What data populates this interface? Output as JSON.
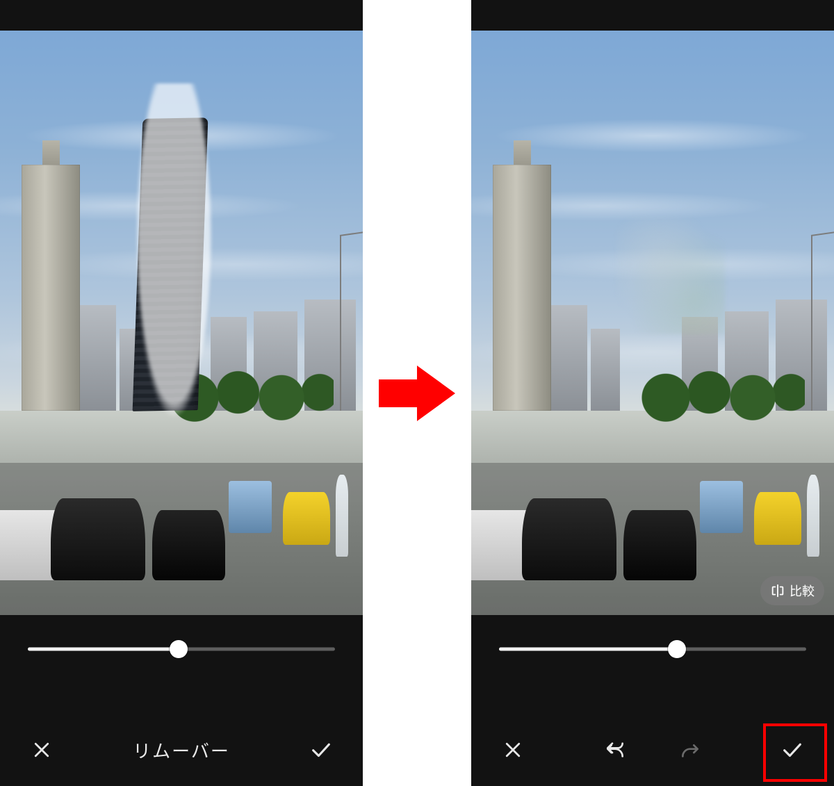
{
  "left": {
    "tool_title": "リムーバー",
    "slider_percent": 49,
    "show_skyscraper": true,
    "show_brush_mask": true
  },
  "right": {
    "compare_label": "比較",
    "slider_percent": 58,
    "show_skyscraper": false
  },
  "icons": {
    "close": "close-icon",
    "check": "check-icon",
    "undo": "undo-icon",
    "redo": "redo-icon",
    "compare": "compare-icon"
  },
  "annotation": {
    "highlight_target": "right-confirm-button"
  }
}
